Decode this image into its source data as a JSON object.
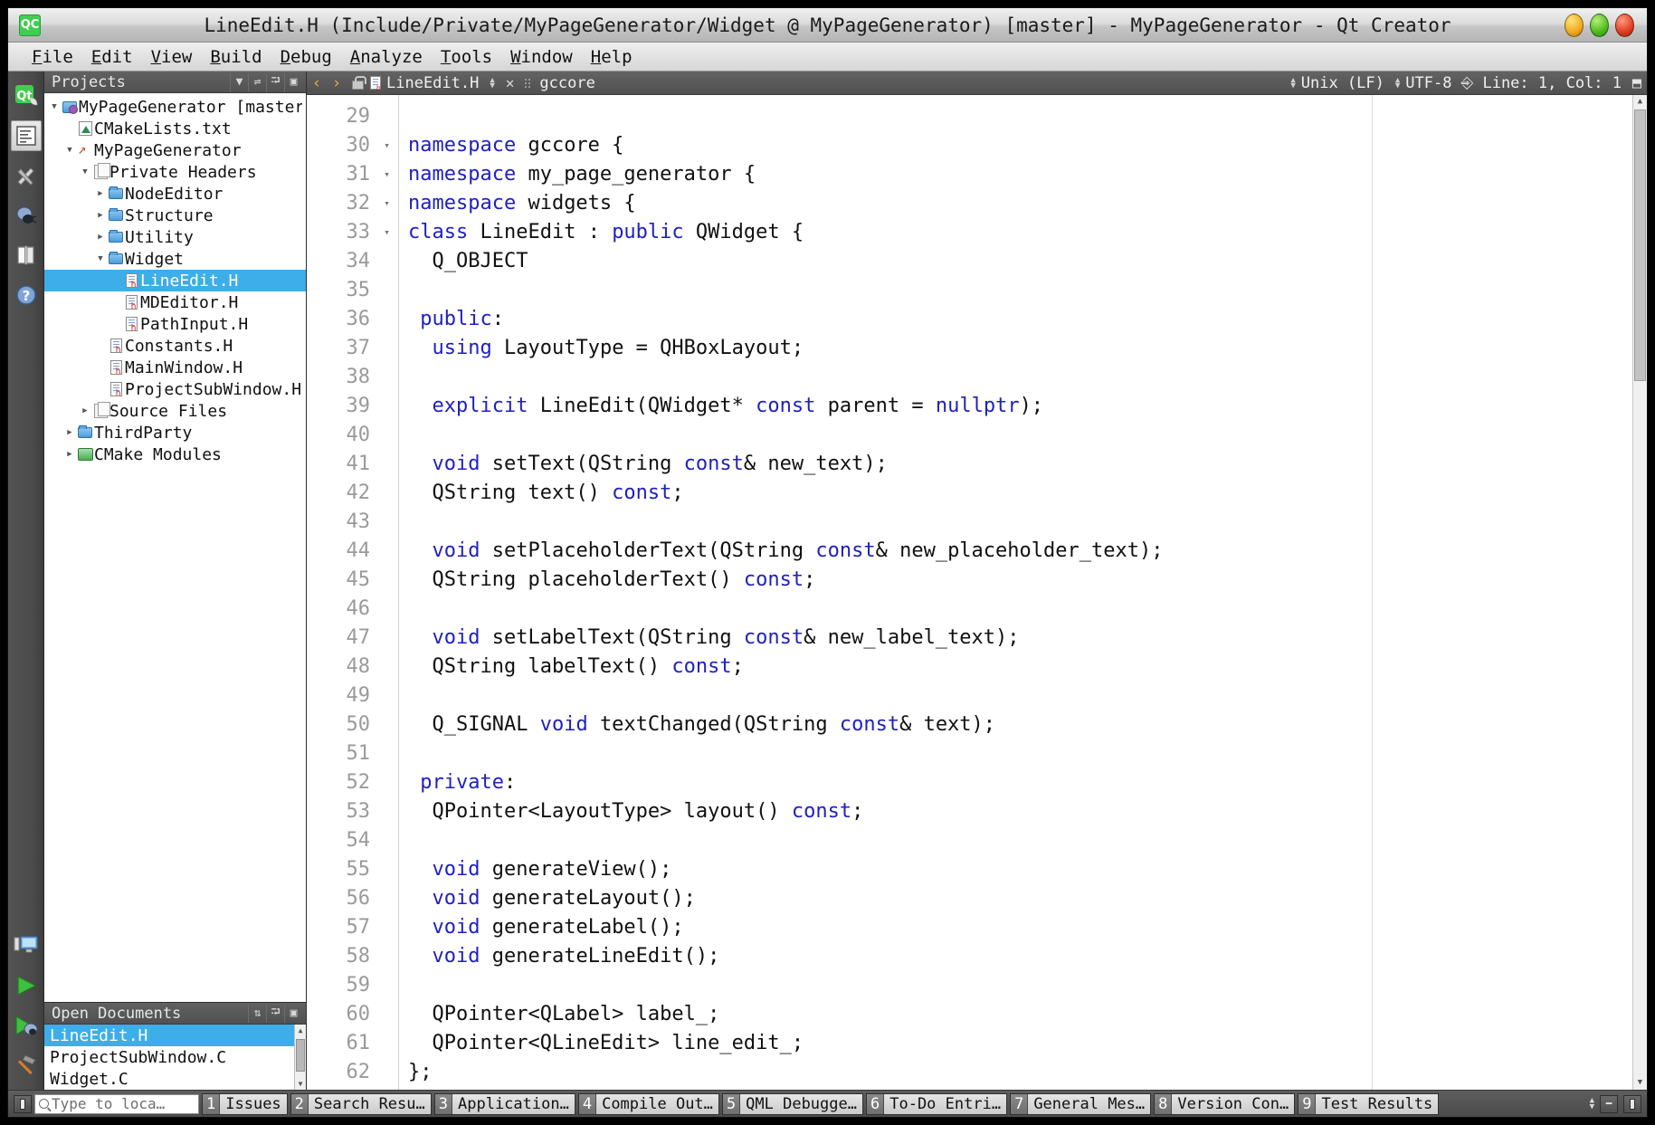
{
  "window": {
    "title": "LineEdit.H (Include/Private/MyPageGenerator/Widget @ MyPageGenerator) [master] - MyPageGenerator - Qt Creator",
    "logo_text": "QC",
    "controls": {
      "minimize": "minimize-button",
      "maximize": "maximize-button",
      "close": "close-button"
    }
  },
  "menubar": {
    "items": [
      {
        "label": "File"
      },
      {
        "label": "Edit"
      },
      {
        "label": "View"
      },
      {
        "label": "Build"
      },
      {
        "label": "Debug"
      },
      {
        "label": "Analyze"
      },
      {
        "label": "Tools"
      },
      {
        "label": "Window"
      },
      {
        "label": "Help"
      }
    ]
  },
  "modebar": {
    "top_icons": [
      {
        "name": "welcome-mode-icon",
        "glyph": "Qt"
      },
      {
        "name": "edit-mode-icon",
        "glyph": "≡"
      },
      {
        "name": "design-mode-icon",
        "glyph": "✒"
      },
      {
        "name": "debug-mode-icon",
        "glyph": "●"
      },
      {
        "name": "projects-mode-icon",
        "glyph": "◫"
      },
      {
        "name": "help-mode-icon",
        "glyph": "?"
      }
    ],
    "bottom_icons": [
      {
        "name": "kit-selector-icon",
        "glyph": "⬜"
      },
      {
        "name": "run-button-icon",
        "glyph": "▶"
      },
      {
        "name": "start-debugging-icon",
        "glyph": "▶"
      },
      {
        "name": "build-button-icon",
        "glyph": "ὒ8"
      }
    ]
  },
  "projects_panel": {
    "title": "Projects",
    "buttons": [
      {
        "name": "filter-tree-button",
        "glyph": "▼"
      },
      {
        "name": "synchronize-button",
        "glyph": "⚭"
      },
      {
        "name": "split-button",
        "glyph": "⬒"
      },
      {
        "name": "close-panel-button",
        "glyph": "▣"
      }
    ],
    "tree": [
      {
        "label": "MyPageGenerator [master]",
        "indent": 0,
        "arrow": "down",
        "icon": "project-icon",
        "selected": false
      },
      {
        "label": "CMakeLists.txt",
        "indent": 1,
        "arrow": "none",
        "icon": "cmake-file-icon",
        "selected": false
      },
      {
        "label": "MyPageGenerator",
        "indent": 1,
        "arrow": "down",
        "icon": "target-icon",
        "selected": false
      },
      {
        "label": "Private Headers",
        "indent": 2,
        "arrow": "down",
        "icon": "header-group-icon",
        "selected": false
      },
      {
        "label": "NodeEditor",
        "indent": 3,
        "arrow": "right",
        "icon": "folder-icon",
        "selected": false
      },
      {
        "label": "Structure",
        "indent": 3,
        "arrow": "right",
        "icon": "folder-icon",
        "selected": false
      },
      {
        "label": "Utility",
        "indent": 3,
        "arrow": "right",
        "icon": "folder-icon",
        "selected": false
      },
      {
        "label": "Widget",
        "indent": 3,
        "arrow": "down",
        "icon": "folder-icon",
        "selected": false
      },
      {
        "label": "LineEdit.H",
        "indent": 4,
        "arrow": "none",
        "icon": "header-file-icon",
        "selected": true
      },
      {
        "label": "MDEditor.H",
        "indent": 4,
        "arrow": "none",
        "icon": "header-file-icon",
        "selected": false
      },
      {
        "label": "PathInput.H",
        "indent": 4,
        "arrow": "none",
        "icon": "header-file-icon",
        "selected": false
      },
      {
        "label": "Constants.H",
        "indent": 3,
        "arrow": "none",
        "icon": "header-file-icon",
        "selected": false
      },
      {
        "label": "MainWindow.H",
        "indent": 3,
        "arrow": "none",
        "icon": "header-file-icon",
        "selected": false
      },
      {
        "label": "ProjectSubWindow.H",
        "indent": 3,
        "arrow": "none",
        "icon": "header-file-icon",
        "selected": false
      },
      {
        "label": "Source Files",
        "indent": 2,
        "arrow": "right",
        "icon": "header-group-icon",
        "selected": false
      },
      {
        "label": "ThirdParty",
        "indent": 1,
        "arrow": "right",
        "icon": "folder-icon",
        "selected": false
      },
      {
        "label": "CMake Modules",
        "indent": 1,
        "arrow": "right",
        "icon": "cmake-modules-icon",
        "selected": false
      }
    ]
  },
  "open_documents": {
    "title": "Open Documents",
    "buttons": [
      {
        "name": "sort-documents-button",
        "glyph": "⇅"
      },
      {
        "name": "split-documents-button",
        "glyph": "⬒"
      },
      {
        "name": "close-documents-button",
        "glyph": "▣"
      }
    ],
    "items": [
      {
        "label": "LineEdit.H",
        "selected": true
      },
      {
        "label": "ProjectSubWindow.C",
        "selected": false
      },
      {
        "label": "Widget.C",
        "selected": false
      }
    ]
  },
  "editor_toolbar": {
    "back_glyph": "‹",
    "forward_glyph": "›",
    "lock_name": "unlock-icon",
    "file_name": "LineEdit.H",
    "close_glyph": "✕",
    "symbol_scope": "gccore",
    "line_ending": "Unix (LF)",
    "encoding": "UTF-8",
    "cursor_position": "Line: 1, Col: 1",
    "split_glyph": "⬒"
  },
  "editor": {
    "first_line": 29,
    "lines": [
      {
        "n": 29,
        "fold": "",
        "tokens": []
      },
      {
        "n": 30,
        "fold": "▾",
        "tokens": [
          {
            "t": "namespace ",
            "k": true
          },
          {
            "t": "gccore {",
            "k": false
          }
        ]
      },
      {
        "n": 31,
        "fold": "▾",
        "tokens": [
          {
            "t": "namespace ",
            "k": true
          },
          {
            "t": "my_page_generator {",
            "k": false
          }
        ]
      },
      {
        "n": 32,
        "fold": "▾",
        "tokens": [
          {
            "t": "namespace ",
            "k": true
          },
          {
            "t": "widgets {",
            "k": false
          }
        ]
      },
      {
        "n": 33,
        "fold": "▾",
        "tokens": [
          {
            "t": "class ",
            "k": true
          },
          {
            "t": "LineEdit : ",
            "k": false
          },
          {
            "t": "public ",
            "k": true
          },
          {
            "t": "QWidget {",
            "k": false
          }
        ]
      },
      {
        "n": 34,
        "fold": "",
        "tokens": [
          {
            "t": "  Q_OBJECT",
            "k": false
          }
        ]
      },
      {
        "n": 35,
        "fold": "",
        "tokens": []
      },
      {
        "n": 36,
        "fold": "",
        "tokens": [
          {
            "t": " ",
            "k": false
          },
          {
            "t": "public",
            "k": true
          },
          {
            "t": ":",
            "k": false
          }
        ]
      },
      {
        "n": 37,
        "fold": "",
        "tokens": [
          {
            "t": "  ",
            "k": false
          },
          {
            "t": "using ",
            "k": true
          },
          {
            "t": "LayoutType = QHBoxLayout;",
            "k": false
          }
        ]
      },
      {
        "n": 38,
        "fold": "",
        "tokens": []
      },
      {
        "n": 39,
        "fold": "",
        "tokens": [
          {
            "t": "  ",
            "k": false
          },
          {
            "t": "explicit ",
            "k": true
          },
          {
            "t": "LineEdit(QWidget* ",
            "k": false
          },
          {
            "t": "const ",
            "k": true
          },
          {
            "t": "parent = ",
            "k": false
          },
          {
            "t": "nullptr",
            "k": true
          },
          {
            "t": ");",
            "k": false
          }
        ]
      },
      {
        "n": 40,
        "fold": "",
        "tokens": []
      },
      {
        "n": 41,
        "fold": "",
        "tokens": [
          {
            "t": "  ",
            "k": false
          },
          {
            "t": "void ",
            "k": true
          },
          {
            "t": "setText(QString ",
            "k": false
          },
          {
            "t": "const",
            "k": true
          },
          {
            "t": "& new_text);",
            "k": false
          }
        ]
      },
      {
        "n": 42,
        "fold": "",
        "tokens": [
          {
            "t": "  QString text() ",
            "k": false
          },
          {
            "t": "const",
            "k": true
          },
          {
            "t": ";",
            "k": false
          }
        ]
      },
      {
        "n": 43,
        "fold": "",
        "tokens": []
      },
      {
        "n": 44,
        "fold": "",
        "tokens": [
          {
            "t": "  ",
            "k": false
          },
          {
            "t": "void ",
            "k": true
          },
          {
            "t": "setPlaceholderText(QString ",
            "k": false
          },
          {
            "t": "const",
            "k": true
          },
          {
            "t": "& new_placeholder_text);",
            "k": false
          }
        ]
      },
      {
        "n": 45,
        "fold": "",
        "tokens": [
          {
            "t": "  QString placeholderText() ",
            "k": false
          },
          {
            "t": "const",
            "k": true
          },
          {
            "t": ";",
            "k": false
          }
        ]
      },
      {
        "n": 46,
        "fold": "",
        "tokens": []
      },
      {
        "n": 47,
        "fold": "",
        "tokens": [
          {
            "t": "  ",
            "k": false
          },
          {
            "t": "void ",
            "k": true
          },
          {
            "t": "setLabelText(QString ",
            "k": false
          },
          {
            "t": "const",
            "k": true
          },
          {
            "t": "& new_label_text);",
            "k": false
          }
        ]
      },
      {
        "n": 48,
        "fold": "",
        "tokens": [
          {
            "t": "  QString labelText() ",
            "k": false
          },
          {
            "t": "const",
            "k": true
          },
          {
            "t": ";",
            "k": false
          }
        ]
      },
      {
        "n": 49,
        "fold": "",
        "tokens": []
      },
      {
        "n": 50,
        "fold": "",
        "tokens": [
          {
            "t": "  Q_SIGNAL ",
            "k": false
          },
          {
            "t": "void ",
            "k": true
          },
          {
            "t": "textChanged(QString ",
            "k": false
          },
          {
            "t": "const",
            "k": true
          },
          {
            "t": "& text);",
            "k": false
          }
        ]
      },
      {
        "n": 51,
        "fold": "",
        "tokens": []
      },
      {
        "n": 52,
        "fold": "",
        "tokens": [
          {
            "t": " ",
            "k": false
          },
          {
            "t": "private",
            "k": true
          },
          {
            "t": ":",
            "k": false
          }
        ]
      },
      {
        "n": 53,
        "fold": "",
        "tokens": [
          {
            "t": "  QPointer<LayoutType> layout() ",
            "k": false
          },
          {
            "t": "const",
            "k": true
          },
          {
            "t": ";",
            "k": false
          }
        ]
      },
      {
        "n": 54,
        "fold": "",
        "tokens": []
      },
      {
        "n": 55,
        "fold": "",
        "tokens": [
          {
            "t": "  ",
            "k": false
          },
          {
            "t": "void ",
            "k": true
          },
          {
            "t": "generateView();",
            "k": false
          }
        ]
      },
      {
        "n": 56,
        "fold": "",
        "tokens": [
          {
            "t": "  ",
            "k": false
          },
          {
            "t": "void ",
            "k": true
          },
          {
            "t": "generateLayout();",
            "k": false
          }
        ]
      },
      {
        "n": 57,
        "fold": "",
        "tokens": [
          {
            "t": "  ",
            "k": false
          },
          {
            "t": "void ",
            "k": true
          },
          {
            "t": "generateLabel();",
            "k": false
          }
        ]
      },
      {
        "n": 58,
        "fold": "",
        "tokens": [
          {
            "t": "  ",
            "k": false
          },
          {
            "t": "void ",
            "k": true
          },
          {
            "t": "generateLineEdit();",
            "k": false
          }
        ]
      },
      {
        "n": 59,
        "fold": "",
        "tokens": []
      },
      {
        "n": 60,
        "fold": "",
        "tokens": [
          {
            "t": "  QPointer<QLabel> label_;",
            "k": false
          }
        ]
      },
      {
        "n": 61,
        "fold": "",
        "tokens": [
          {
            "t": "  QPointer<QLineEdit> line_edit_;",
            "k": false
          }
        ]
      },
      {
        "n": 62,
        "fold": "",
        "tokens": [
          {
            "t": "};",
            "k": false
          }
        ]
      }
    ]
  },
  "statusbar": {
    "locator_placeholder": "Type to loca…",
    "panes": [
      {
        "num": "1",
        "label": "Issues"
      },
      {
        "num": "2",
        "label": "Search Resu…"
      },
      {
        "num": "3",
        "label": "Application…"
      },
      {
        "num": "4",
        "label": "Compile Out…"
      },
      {
        "num": "5",
        "label": "QML Debugge…"
      },
      {
        "num": "6",
        "label": "To-Do Entri…"
      },
      {
        "num": "7",
        "label": "General Mes…"
      },
      {
        "num": "8",
        "label": "Version Con…"
      },
      {
        "num": "9",
        "label": "Test Results"
      }
    ]
  },
  "colors": {
    "selection": "#3daee9",
    "keyword": "#2020c0",
    "qt_green": "#41cd52"
  }
}
